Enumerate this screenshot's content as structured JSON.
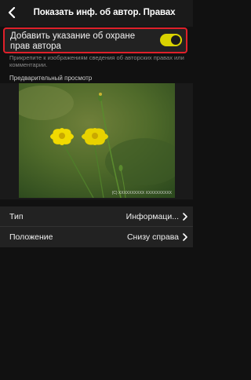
{
  "header": {
    "title": "Показать инф. об автор. Правах",
    "back_icon": "chevron-left-icon"
  },
  "toggle_row": {
    "label": "Добавить указание об охране прав автора",
    "enabled": true,
    "accent_color": "#d9d200",
    "highlight_color": "#e0202a"
  },
  "description": "Прикрепите к изображениям сведения об авторских правах или комментарии.",
  "preview": {
    "label": "Предварительный просмотр",
    "watermark": "(C) XXXXXXXXXX XXXXXXXXXX"
  },
  "settings": [
    {
      "label": "Тип",
      "value": "Информаци...",
      "icon": "chevron-right-icon"
    },
    {
      "label": "Положение",
      "value": "Снизу справа",
      "icon": "chevron-right-icon"
    }
  ]
}
